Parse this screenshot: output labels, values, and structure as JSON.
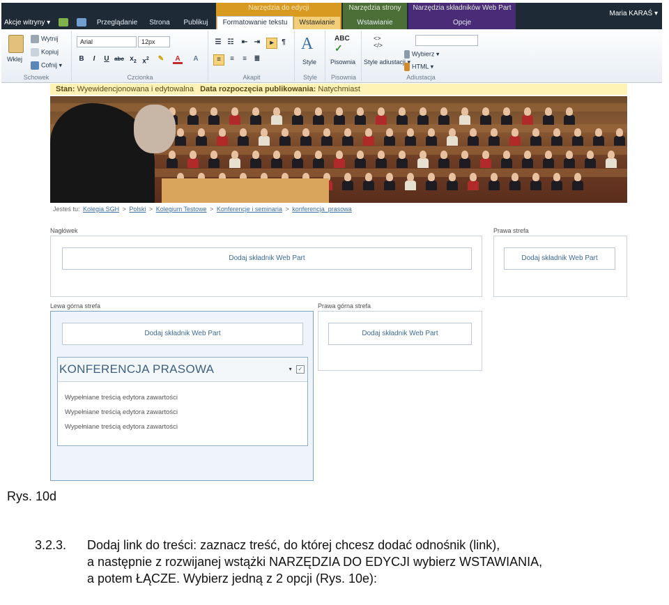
{
  "topbar": {
    "site_actions": "Akcje witryny ▾",
    "tabs": [
      "Przeglądanie",
      "Strona",
      "Publikuj"
    ],
    "ctx_edit_title": "Narzędzia do edycji",
    "ctx_edit_tabs": [
      "Formatowanie tekstu",
      "Wstawianie"
    ],
    "ctx_page_title": "Narzędzia strony",
    "ctx_page_tab": "Wstawianie",
    "ctx_wp_title": "Narzędzia składników Web Part",
    "ctx_wp_tab": "Opcje",
    "user": "Maria KARAŚ ▾"
  },
  "ribbon": {
    "paste": "Wklej",
    "cut": "Wytnij",
    "copy": "Kopiuj",
    "undo": "Cofnij ▾",
    "clipboard": "Schowek",
    "font_name": "Arial",
    "font_size": "12px",
    "font_group": "Czcionka",
    "paragraph_group": "Akapit",
    "styles_btn": "Style",
    "styles_group": "Style",
    "spelling_btn": "Pisownia",
    "spelling_group": "Pisownia",
    "markup_styles": "Style adiustacji ▾",
    "select": "Wybierz ▾",
    "html": "HTML ▾",
    "markup_group": "Adiustacja"
  },
  "status": {
    "label1": "Stan:",
    "value1": "Wyewidencjonowana i edytowalna",
    "label2": "Data rozpoczęcia publikowania:",
    "value2": "Natychmiast"
  },
  "breadcrumb": {
    "prefix": "Jesteś tu:",
    "items": [
      "Kolegia SGH",
      "Polski",
      "Kolegium Testowe",
      "Konferencje i seminaria",
      "konferencja_prasowa"
    ],
    "sep": ">"
  },
  "zones": {
    "header_label": "Nagłówek",
    "right_label": "Prawa strefa",
    "left_top_label": "Lewa górna strefa",
    "right_top_label": "Prawa górna strefa",
    "add_web_part": "Dodaj składnik Web Part"
  },
  "webpart": {
    "title": "KONFERENCJA PRASOWA",
    "lines": [
      "Wypełniane treścią edytora zawartości",
      "Wypełniane treścią edytora zawartości",
      "Wypełniane treścią edytora zawartości"
    ]
  },
  "caption": "Rys. 10d",
  "paragraph": {
    "number": "3.2.3.",
    "line1": "Dodaj link do treści: zaznacz treść, do której chcesz dodać odnośnik (link),",
    "line2": "a następnie z rozwijanej wstążki NARZĘDZIA DO EDYCJI wybierz WSTAWIANIA,",
    "line3": "a potem ŁĄCZE. Wybierz jedną z 2 opcji (Rys. 10e):"
  }
}
